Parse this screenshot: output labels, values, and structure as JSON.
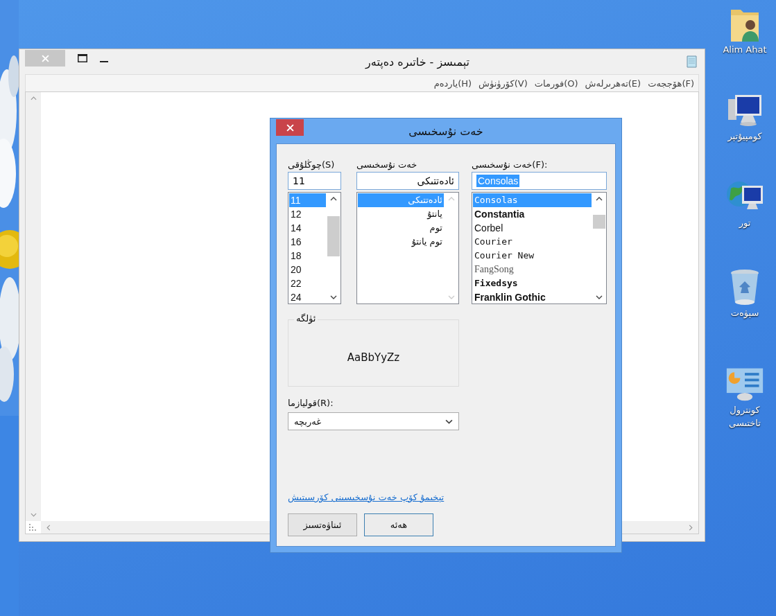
{
  "notepad": {
    "title": "تېمىسز - خاتىره دەپتەر",
    "menu": [
      "هۆججەت(F)",
      "تەھرىرلەش(E)",
      "فورمات(O)",
      "كۆرۈنۈش(V)",
      "ياردەم(H)"
    ]
  },
  "dialog": {
    "title": "خەت نۇسخىسى",
    "font": {
      "label": "خەت نۇسخىسى(F):",
      "value": "Consolas",
      "items": [
        {
          "label": "Consolas",
          "kind": "mono",
          "selected": true
        },
        {
          "label": "Constantia",
          "kind": "bold",
          "selected": false
        },
        {
          "label": "Corbel",
          "kind": "sans",
          "selected": false
        },
        {
          "label": "Courier",
          "kind": "mono",
          "selected": false
        },
        {
          "label": "Courier New",
          "kind": "mono",
          "selected": false
        },
        {
          "label": "FangSong",
          "kind": "light",
          "selected": false
        },
        {
          "label": "Fixedsys",
          "kind": "bold-mono",
          "selected": false
        },
        {
          "label": "Franklin Gothic",
          "kind": "bold",
          "selected": false
        }
      ]
    },
    "style": {
      "label": "خەت نۇسخىسى",
      "value": "ئادەتتىكى",
      "items": [
        {
          "label": "ئادەتتىكى",
          "selected": true
        },
        {
          "label": "يانتۇ",
          "selected": false
        },
        {
          "label": "توم",
          "selected": false
        },
        {
          "label": "توم يانتۇ",
          "selected": false
        }
      ]
    },
    "size": {
      "label": "چوڭلۇقى(S)",
      "value": "11",
      "items": [
        {
          "label": "11",
          "selected": true
        },
        {
          "label": "12",
          "selected": false
        },
        {
          "label": "14",
          "selected": false
        },
        {
          "label": "16",
          "selected": false
        },
        {
          "label": "18",
          "selected": false
        },
        {
          "label": "20",
          "selected": false
        },
        {
          "label": "22",
          "selected": false
        },
        {
          "label": "24",
          "selected": false
        }
      ]
    },
    "sample": {
      "label": "ئۈلگە",
      "text": "AaBbYyZz"
    },
    "script": {
      "label": "قوليازما(R):",
      "value": "غەربچە"
    },
    "link": "تېخىمۇ كۆپ خەت نۇسخىسىنى كۆرسىتىش",
    "buttons": [
      {
        "label": "ھەئە",
        "default": true
      },
      {
        "label": "ئىناۋەتسىز",
        "default": false
      }
    ]
  },
  "desktop_icons": [
    {
      "label": "Alim Ahat",
      "kind": "user-folder"
    },
    {
      "label": "كومپيۇتېر",
      "kind": "computer"
    },
    {
      "label": "تور",
      "kind": "network"
    },
    {
      "label": "سېۋەت",
      "kind": "recycle-bin"
    },
    {
      "label": "كونترول تاختىسى",
      "kind": "control-panel"
    }
  ]
}
